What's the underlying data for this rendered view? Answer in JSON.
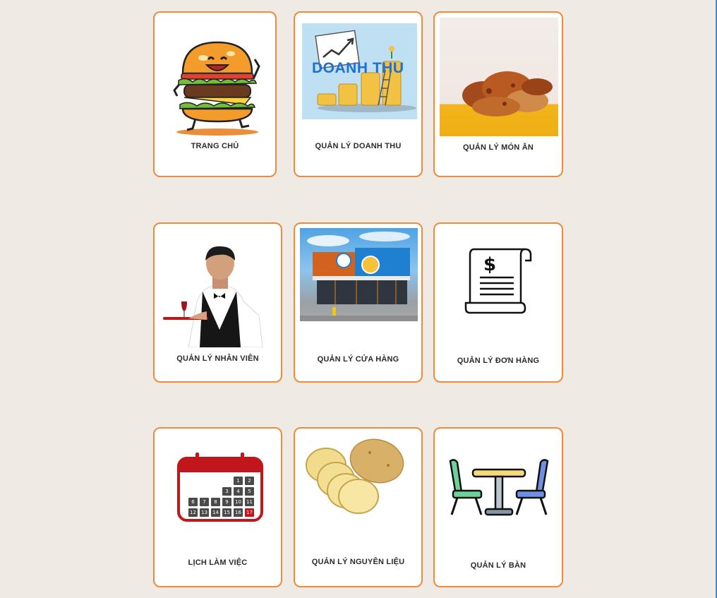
{
  "tiles": [
    {
      "label": "TRANG CHỦ",
      "icon": "burger-mascot-icon"
    },
    {
      "label": "QUẢN LÝ DOANH THU",
      "icon": "revenue-chart-icon",
      "image_text": "DOANH THU"
    },
    {
      "label": "QUẢN LÝ MÓN ĂN",
      "icon": "fried-chicken-icon"
    },
    {
      "label": "QUẢN LÝ NHÂN VIÊN",
      "icon": "waiter-photo-icon"
    },
    {
      "label": "QUẢN LÝ CỬA HÀNG",
      "icon": "storefront-photo-icon"
    },
    {
      "label": "QUẢN LÝ ĐƠN HÀNG",
      "icon": "invoice-scroll-icon"
    },
    {
      "label": "LỊCH LÀM VIỆC",
      "icon": "calendar-icon",
      "calendar_days": [
        "1",
        "2",
        "3",
        "4",
        "5",
        "6",
        "7",
        "8",
        "9",
        "10",
        "11",
        "12",
        "13",
        "14",
        "15",
        "16",
        "17"
      ]
    },
    {
      "label": "QUẢN LÝ NGUYÊN LIỆU",
      "icon": "potato-icon"
    },
    {
      "label": "QUẢN LÝ BÀN",
      "icon": "table-chairs-icon"
    }
  ],
  "colors": {
    "accent": "#f08a3a",
    "background": "#efebe4",
    "card": "#ffffff"
  }
}
